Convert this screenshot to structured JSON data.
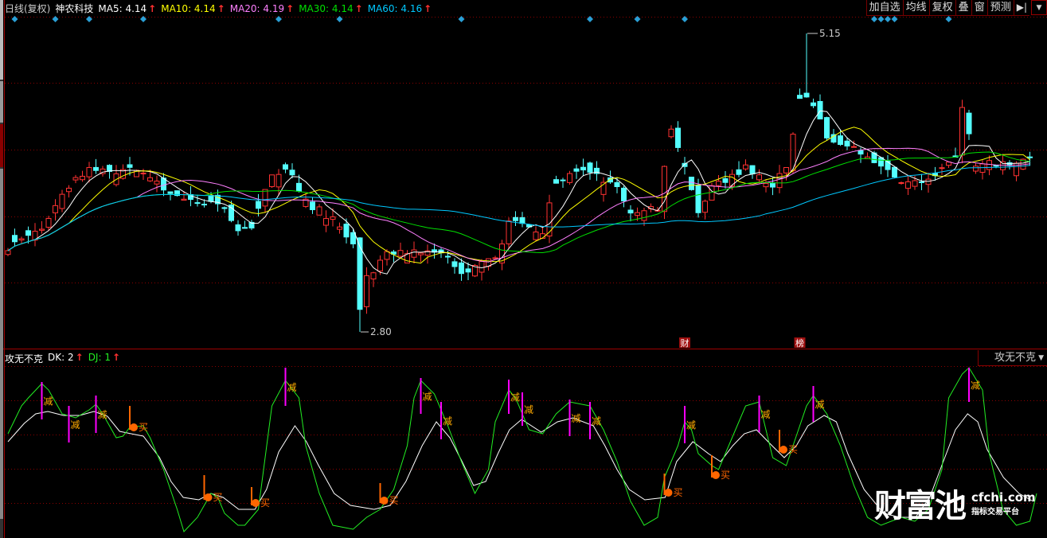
{
  "header": {
    "period": "日线(复权)",
    "stock_name": "神农科技",
    "ma_values": [
      {
        "label": "MA5: 4.14",
        "color": "#ffffff"
      },
      {
        "label": "MA10: 4.14",
        "color": "#ffff00"
      },
      {
        "label": "MA20: 4.19",
        "color": "#ff80ff"
      },
      {
        "label": "MA30: 4.14",
        "color": "#00e000"
      },
      {
        "label": "MA60: 4.16",
        "color": "#00c8ff"
      }
    ],
    "up_arrow": "🠕"
  },
  "toolbar": {
    "buttons": [
      "加自选",
      "均线",
      "复权",
      "叠",
      "窗",
      "预测"
    ],
    "collapse_icon": "▶|",
    "dropdown_icon": "▼"
  },
  "indicator": {
    "name": "攻无不克",
    "dk_label": "DK: 2",
    "dj_label": "DJ: 1",
    "selector_label": "攻无不克",
    "sell_label": "减",
    "buy_label": "买"
  },
  "watermark": {
    "brand": "财富池",
    "url": "cfchi.com",
    "slogan": "指标交易平台"
  },
  "colors": {
    "up": "#ff3232",
    "down": "#54ffff",
    "grid": "#8a0000",
    "dk": "#22ee22",
    "dj": "#ffffff",
    "sell": "#ff00ff",
    "buy": "#ff6600",
    "signal_text": "#ffaa00",
    "marker": "#2a9fd6"
  },
  "chart_data": {
    "type": "candlestick",
    "bars": 152,
    "price_range": [
      2.8,
      5.15
    ],
    "max_label": "5.15",
    "min_label": "2.80",
    "max_bar": 118,
    "min_bar": 52,
    "close_keypoints": [
      [
        0,
        3.47
      ],
      [
        5,
        3.6
      ],
      [
        8,
        3.91
      ],
      [
        12,
        4.07
      ],
      [
        18,
        4.07
      ],
      [
        21,
        4.03
      ],
      [
        26,
        3.82
      ],
      [
        31,
        3.82
      ],
      [
        34,
        3.6
      ],
      [
        36,
        3.63
      ],
      [
        39,
        4.03
      ],
      [
        41,
        4.1
      ],
      [
        44,
        3.82
      ],
      [
        48,
        3.69
      ],
      [
        51,
        3.47
      ],
      [
        52,
        2.95
      ],
      [
        53,
        3.22
      ],
      [
        56,
        3.41
      ],
      [
        61,
        3.44
      ],
      [
        65,
        3.41
      ],
      [
        67,
        3.25
      ],
      [
        72,
        3.38
      ],
      [
        74,
        3.66
      ],
      [
        79,
        3.6
      ],
      [
        81,
        4.0
      ],
      [
        86,
        4.07
      ],
      [
        90,
        3.94
      ],
      [
        92,
        3.72
      ],
      [
        96,
        3.78
      ],
      [
        98,
        4.41
      ],
      [
        102,
        3.75
      ],
      [
        104,
        3.94
      ],
      [
        109,
        4.1
      ],
      [
        113,
        3.94
      ],
      [
        115,
        4.1
      ],
      [
        117,
        4.66
      ],
      [
        119,
        4.6
      ],
      [
        121,
        4.35
      ],
      [
        123,
        4.25
      ],
      [
        126,
        4.22
      ],
      [
        128,
        4.13
      ],
      [
        132,
        4.0
      ],
      [
        135,
        3.97
      ],
      [
        140,
        4.16
      ],
      [
        141,
        4.54
      ],
      [
        143,
        4.13
      ],
      [
        148,
        4.13
      ],
      [
        151,
        4.16
      ]
    ],
    "moving_averages": [
      5,
      10,
      20,
      30,
      60
    ],
    "event_markers": [
      1,
      7,
      12,
      20,
      40,
      49,
      67,
      86,
      93,
      100,
      128,
      129,
      130,
      131,
      139
    ],
    "event_tags": [
      {
        "bar": 100,
        "label": "财"
      },
      {
        "bar": 117,
        "label": "榜"
      }
    ],
    "indicator": {
      "range": [
        0,
        108
      ],
      "dk": [
        [
          0,
          65.5
        ],
        [
          2,
          83
        ],
        [
          3,
          88
        ],
        [
          5,
          97
        ],
        [
          6,
          93
        ],
        [
          7,
          85.5
        ],
        [
          8,
          78
        ],
        [
          10,
          75.5
        ],
        [
          12,
          80.5
        ],
        [
          13,
          84
        ],
        [
          14,
          78
        ],
        [
          16,
          63
        ],
        [
          17,
          64
        ],
        [
          18,
          69.5
        ],
        [
          20,
          70.5
        ],
        [
          21,
          63
        ],
        [
          23,
          43
        ],
        [
          25,
          18
        ],
        [
          26,
          4
        ],
        [
          28,
          13
        ],
        [
          30,
          28
        ],
        [
          31,
          25.5
        ],
        [
          32,
          15.5
        ],
        [
          34,
          8
        ],
        [
          35,
          8
        ],
        [
          37,
          18
        ],
        [
          38,
          50.5
        ],
        [
          39,
          83
        ],
        [
          41,
          99
        ],
        [
          43,
          88
        ],
        [
          44,
          58
        ],
        [
          46,
          28
        ],
        [
          48,
          8
        ],
        [
          51,
          5.5
        ],
        [
          53,
          13
        ],
        [
          55,
          18
        ],
        [
          57,
          30.5
        ],
        [
          59,
          58
        ],
        [
          60,
          88
        ],
        [
          61,
          99
        ],
        [
          63,
          90.5
        ],
        [
          65,
          70.5
        ],
        [
          67,
          48
        ],
        [
          69,
          28
        ],
        [
          71,
          43
        ],
        [
          72,
          73
        ],
        [
          74,
          93
        ],
        [
          75,
          88
        ],
        [
          77,
          68
        ],
        [
          79,
          65.5
        ],
        [
          81,
          78
        ],
        [
          83,
          85.5
        ],
        [
          86,
          83
        ],
        [
          88,
          68
        ],
        [
          90,
          48
        ],
        [
          92,
          23
        ],
        [
          94,
          8
        ],
        [
          96,
          13
        ],
        [
          97,
          38
        ],
        [
          99,
          58
        ],
        [
          100,
          73
        ],
        [
          101,
          68
        ],
        [
          102,
          53
        ],
        [
          104,
          45.5
        ],
        [
          105,
          43
        ],
        [
          106,
          53
        ],
        [
          108,
          73
        ],
        [
          109,
          83
        ],
        [
          111,
          85.5
        ],
        [
          112,
          68
        ],
        [
          113,
          50.5
        ],
        [
          115,
          45.5
        ],
        [
          116,
          58
        ],
        [
          118,
          83
        ],
        [
          119,
          89.5
        ],
        [
          121,
          78
        ],
        [
          123,
          58
        ],
        [
          125,
          33
        ],
        [
          127,
          13
        ],
        [
          129,
          8
        ],
        [
          132,
          13
        ],
        [
          134,
          10.5
        ],
        [
          136,
          18
        ],
        [
          138,
          43
        ],
        [
          139,
          88
        ],
        [
          141,
          103
        ],
        [
          142,
          107
        ],
        [
          144,
          93
        ],
        [
          145,
          53
        ],
        [
          147,
          18
        ],
        [
          149,
          8
        ],
        [
          151,
          10.5
        ],
        [
          152,
          28
        ]
      ],
      "dj": [
        [
          0,
          60.5
        ],
        [
          2.4,
          72
        ],
        [
          4.1,
          78
        ],
        [
          5.9,
          79.5
        ],
        [
          8.2,
          77
        ],
        [
          10.6,
          77
        ],
        [
          12.7,
          79.5
        ],
        [
          14.7,
          76.5
        ],
        [
          16.5,
          67
        ],
        [
          18.2,
          65.5
        ],
        [
          20,
          64
        ],
        [
          22.4,
          50.5
        ],
        [
          24.1,
          35.5
        ],
        [
          25.9,
          25.5
        ],
        [
          28.2,
          24
        ],
        [
          30,
          28
        ],
        [
          31.8,
          25.5
        ],
        [
          34.1,
          18
        ],
        [
          36.5,
          18
        ],
        [
          38.2,
          30.5
        ],
        [
          40,
          54
        ],
        [
          42.4,
          70.5
        ],
        [
          44.1,
          60.5
        ],
        [
          45.9,
          45.5
        ],
        [
          48.2,
          28
        ],
        [
          50.6,
          20.5
        ],
        [
          54.1,
          18
        ],
        [
          56.5,
          20.5
        ],
        [
          58.8,
          35.5
        ],
        [
          61.2,
          58
        ],
        [
          63.3,
          73
        ],
        [
          65.3,
          63
        ],
        [
          67.1,
          48
        ],
        [
          68.8,
          33
        ],
        [
          70.6,
          35.5
        ],
        [
          72.4,
          53
        ],
        [
          74.1,
          68
        ],
        [
          75.9,
          74.5
        ],
        [
          78.8,
          66.5
        ],
        [
          81.2,
          73
        ],
        [
          83.5,
          75.5
        ],
        [
          86.5,
          70.5
        ],
        [
          88.2,
          58
        ],
        [
          90,
          43
        ],
        [
          91.8,
          30.5
        ],
        [
          94.1,
          24
        ],
        [
          97.1,
          25.5
        ],
        [
          98.8,
          48
        ],
        [
          101.2,
          60.5
        ],
        [
          103.5,
          53
        ],
        [
          105.3,
          48
        ],
        [
          107.1,
          58
        ],
        [
          108.8,
          65.5
        ],
        [
          110.6,
          68
        ],
        [
          112.9,
          58
        ],
        [
          114.7,
          50.5
        ],
        [
          116.5,
          58
        ],
        [
          118.2,
          70.5
        ],
        [
          120.6,
          77
        ],
        [
          122.4,
          73
        ],
        [
          124.1,
          53
        ],
        [
          126.5,
          30.5
        ],
        [
          129.4,
          15.5
        ],
        [
          131.8,
          13
        ],
        [
          134.1,
          13
        ],
        [
          136.2,
          25.5
        ],
        [
          138.2,
          48
        ],
        [
          140,
          68
        ],
        [
          141.8,
          78
        ],
        [
          143.3,
          73
        ],
        [
          144.7,
          55.5
        ],
        [
          147.1,
          38
        ],
        [
          149.4,
          28
        ],
        [
          151.5,
          23
        ]
      ],
      "sell_signals": [
        [
          5,
          98,
          74.5
        ],
        [
          9,
          83,
          60
        ],
        [
          13,
          89.5,
          66
        ],
        [
          41,
          107,
          83
        ],
        [
          61,
          100.5,
          78
        ],
        [
          64,
          85.5,
          62
        ],
        [
          74,
          99.5,
          78
        ],
        [
          76,
          91.5,
          70.5
        ],
        [
          83,
          87,
          64
        ],
        [
          86,
          85.5,
          62
        ],
        [
          100,
          83,
          59.5
        ],
        [
          111,
          89.5,
          66.5
        ],
        [
          119,
          95.5,
          73
        ],
        [
          142,
          107,
          85.5
        ]
      ],
      "buy_signals": [
        [
          18,
          83,
          68
        ],
        [
          29,
          39.5,
          24
        ],
        [
          36,
          32,
          20.5
        ],
        [
          55,
          34.5,
          22
        ],
        [
          97,
          40.5,
          27
        ],
        [
          104,
          52,
          38
        ],
        [
          114,
          68,
          54
        ]
      ]
    }
  }
}
